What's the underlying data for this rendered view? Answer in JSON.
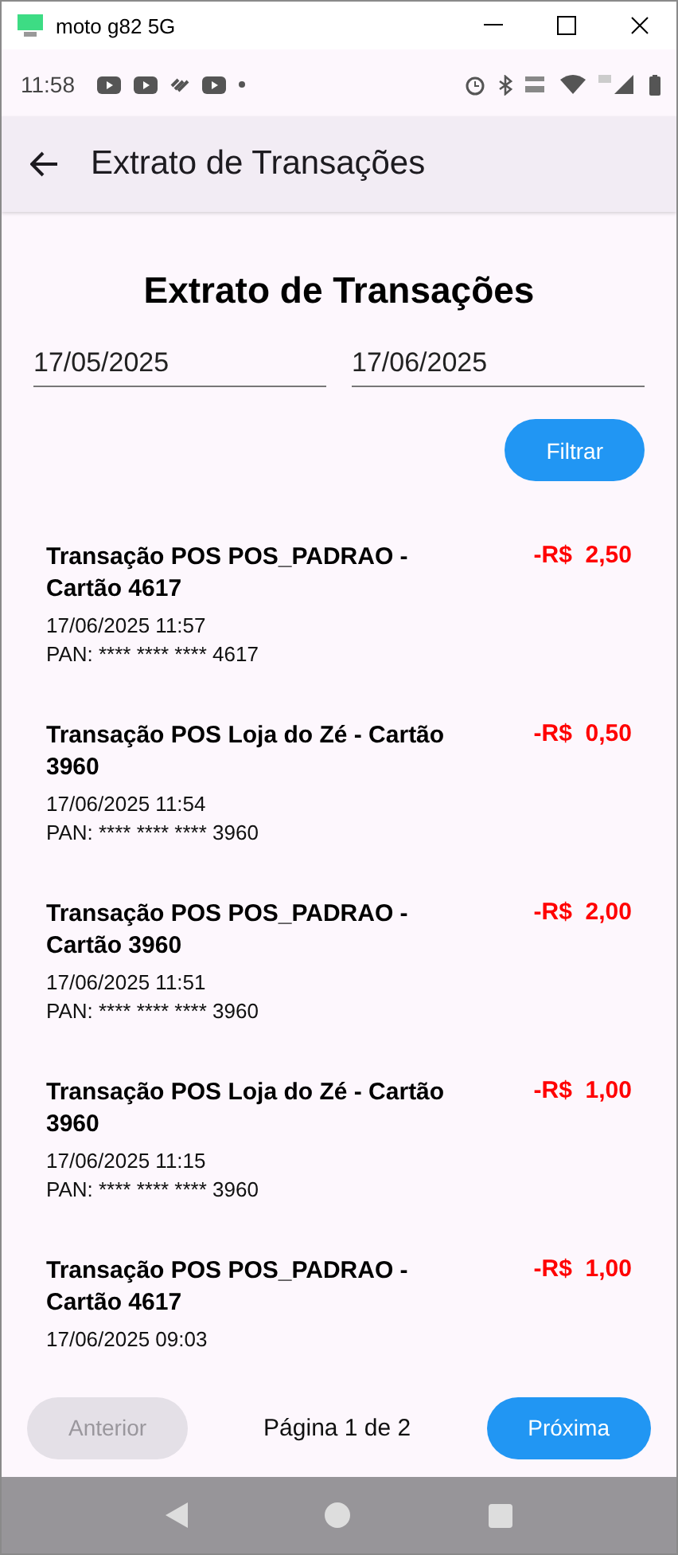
{
  "window": {
    "title": "moto g82 5G"
  },
  "status_bar": {
    "time": "11:58"
  },
  "app_bar": {
    "title": "Extrato de Transações"
  },
  "heading": "Extrato de Transações",
  "date_fields": [
    {
      "value": "17/05/2025"
    },
    {
      "value": "17/06/2025"
    }
  ],
  "filter_button": "Filtrar",
  "transactions": [
    {
      "title": "Transação POS POS_PADRAO - Cartão 4617",
      "amount": "-R$  2,50",
      "datetime": "17/06/2025 11:57",
      "pan": "PAN: **** **** **** 4617"
    },
    {
      "title": "Transação POS Loja do Zé - Cartão 3960",
      "amount": "-R$  0,50",
      "datetime": "17/06/2025 11:54",
      "pan": "PAN: **** **** **** 3960"
    },
    {
      "title": "Transação POS POS_PADRAO - Cartão 3960",
      "amount": "-R$  2,00",
      "datetime": "17/06/2025 11:51",
      "pan": "PAN: **** **** **** 3960"
    },
    {
      "title": "Transação POS Loja do Zé - Cartão 3960",
      "amount": "-R$  1,00",
      "datetime": "17/06/2025 11:15",
      "pan": "PAN: **** **** **** 3960"
    },
    {
      "title": "Transação POS POS_PADRAO - Cartão 4617",
      "amount": "-R$  1,00",
      "datetime": "17/06/2025 09:03"
    }
  ],
  "pagination": {
    "previous": {
      "label": "Anterior",
      "disabled": true
    },
    "page": "Página 1 de 2",
    "next": {
      "label": "Próxima",
      "disabled": false
    }
  }
}
